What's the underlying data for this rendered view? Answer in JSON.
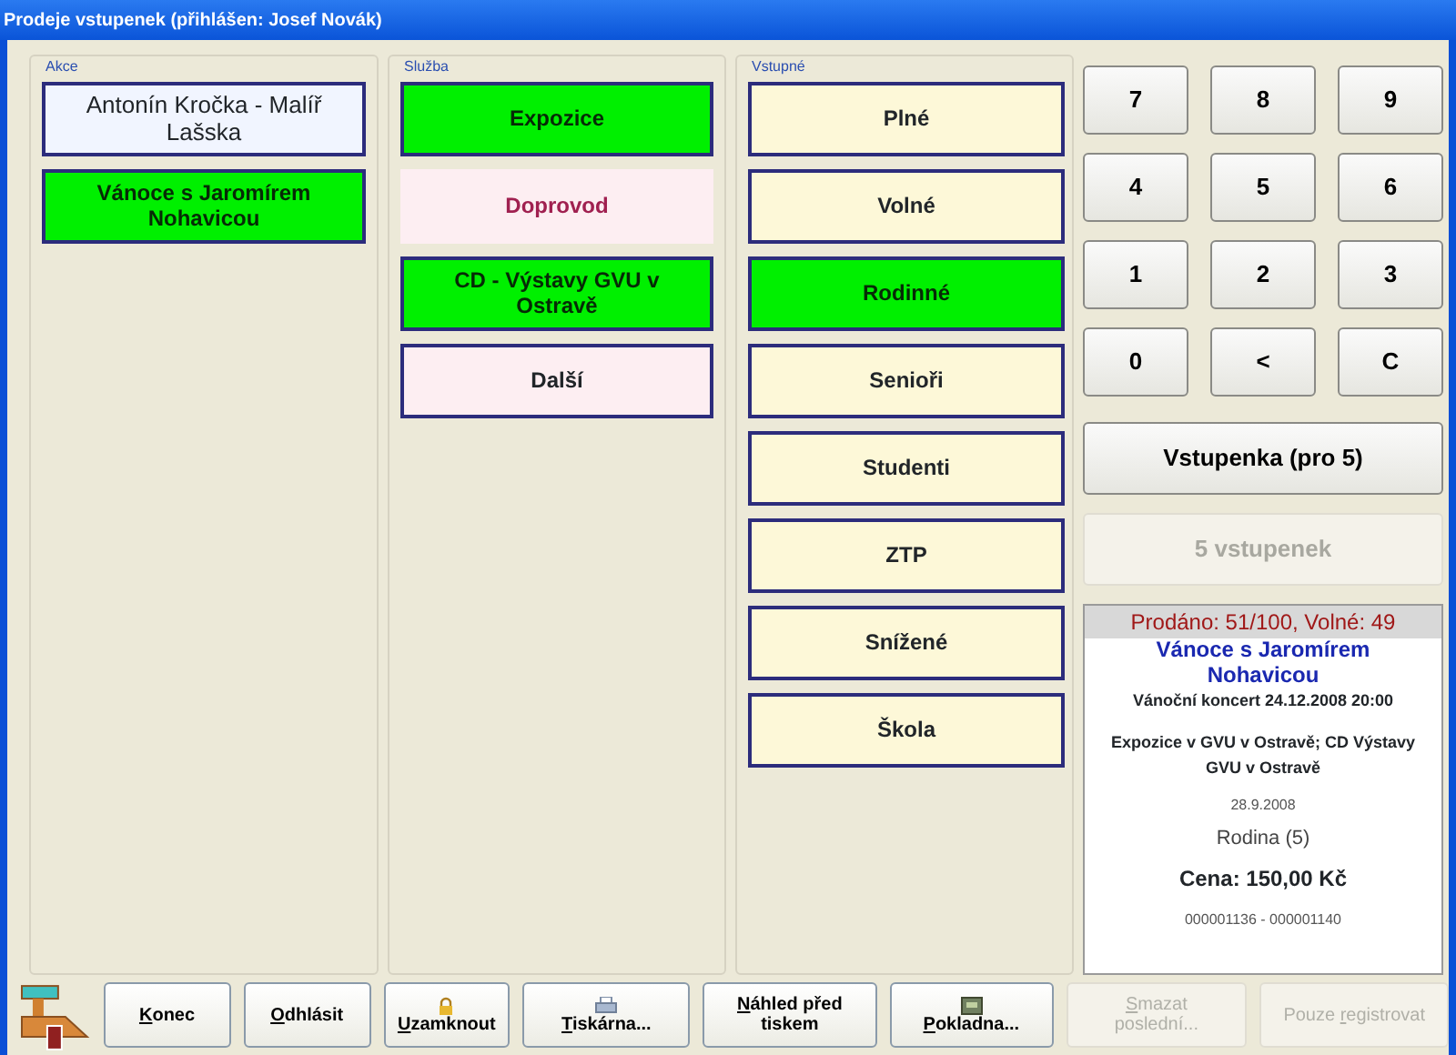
{
  "window": {
    "title": "Prodeje vstupenek (přihlášen: Josef Novák)"
  },
  "akce": {
    "label": "Akce",
    "items": [
      {
        "label": "Antonín Kročka - Malíř Lašska",
        "selected": false
      },
      {
        "label": "Vánoce s Jaromírem Nohavicou",
        "selected": true
      }
    ]
  },
  "sluzba": {
    "label": "Služba",
    "items": [
      {
        "label": "Expozice",
        "selected": true,
        "kind": "normal"
      },
      {
        "label": "Doprovod",
        "selected": false,
        "kind": "flat"
      },
      {
        "label": "CD - Výstavy GVU v Ostravě",
        "selected": true,
        "kind": "normal"
      },
      {
        "label": "Další",
        "selected": false,
        "kind": "normal"
      }
    ]
  },
  "vstupne": {
    "label": "Vstupné",
    "items": [
      {
        "label": "Plné",
        "selected": false
      },
      {
        "label": "Volné",
        "selected": false
      },
      {
        "label": "Rodinné",
        "selected": true
      },
      {
        "label": "Senioři",
        "selected": false
      },
      {
        "label": "Studenti",
        "selected": false
      },
      {
        "label": "ZTP",
        "selected": false
      },
      {
        "label": "Snížené",
        "selected": false
      },
      {
        "label": "Škola",
        "selected": false
      }
    ]
  },
  "keypad": [
    "7",
    "8",
    "9",
    "4",
    "5",
    "6",
    "1",
    "2",
    "3",
    "0",
    "<",
    "C"
  ],
  "ticket_button": {
    "label": "Vstupenka (pro 5)",
    "disabled": false
  },
  "tickets_button": {
    "label": "5 vstupenek",
    "disabled": true
  },
  "summary": {
    "header": "Prodáno: 51/100, Volné: 49",
    "lines": [
      {
        "kind": "event",
        "text": "Vánoce s Jaromírem Nohavicou"
      },
      {
        "kind": "subtitle",
        "text": "Vánoční koncert 24.12.2008 20:00"
      },
      {
        "kind": "services",
        "text": "Expozice v GVU v Ostravě; CD Výstavy GVU v Ostravě"
      },
      {
        "kind": "small",
        "text": "28.9.2008"
      },
      {
        "kind": "type",
        "text": "Rodina (5)"
      },
      {
        "kind": "price",
        "text": "Cena: 150,00 Kč"
      },
      {
        "kind": "small",
        "text": "000001136 - 000001140"
      }
    ]
  },
  "toolbar": [
    {
      "key": "K",
      "after": "onec",
      "kind": "plain",
      "disabled": false
    },
    {
      "key": "O",
      "after": "dhlásit",
      "kind": "plain",
      "disabled": false
    },
    {
      "key": "U",
      "after": "zamknout",
      "kind": "lock",
      "disabled": false
    },
    {
      "key": "T",
      "after": "iskárna...",
      "kind": "printer",
      "disabled": false
    },
    {
      "key": "N",
      "after": "áhled před tiskem",
      "kind": "plain",
      "disabled": false
    },
    {
      "key": "P",
      "after": "okladna...",
      "kind": "cashbox",
      "disabled": false
    },
    {
      "key": "S",
      "after": "mazat poslední...",
      "kind": "plain",
      "disabled": true
    },
    {
      "before": "Pouze ",
      "key": "r",
      "after": "egistrovat",
      "kind": "plain",
      "disabled": true
    }
  ]
}
